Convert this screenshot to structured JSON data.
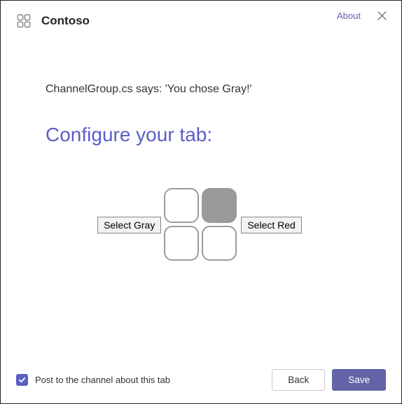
{
  "header": {
    "title": "Contoso",
    "about_label": "About"
  },
  "content": {
    "status_text": "ChannelGroup.cs says: 'You chose Gray!'",
    "heading": "Configure your tab:",
    "select_gray_label": "Select Gray",
    "select_red_label": "Select Red"
  },
  "footer": {
    "checkbox_label": "Post to the channel about this tab",
    "back_label": "Back",
    "save_label": "Save"
  }
}
